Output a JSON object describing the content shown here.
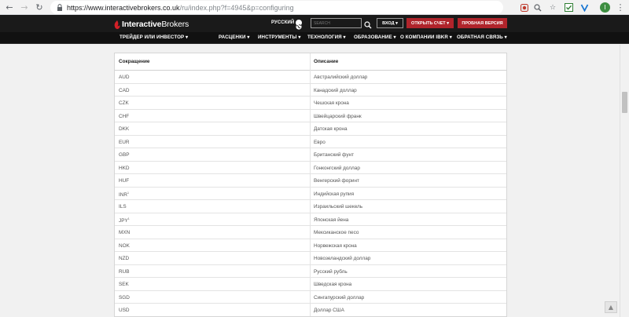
{
  "browser": {
    "url_host": "https://www.interactivebrokers.co.uk",
    "url_path": "/ru/index.php?f=4945&p=configuring",
    "back_icon": "arrow-left-icon",
    "forward_icon": "arrow-right-icon",
    "reload_icon": "reload-icon",
    "avatar_letter": "I",
    "menu_glyph": "⋮",
    "back_glyph": "←",
    "forward_glyph": "→",
    "reload_glyph": "↻",
    "star_glyph": "☆"
  },
  "header": {
    "language": "РУССКИЙ",
    "search_placeholder": "SEARCH",
    "login_label": "ВХОД ▾",
    "open_account_label": "ОТКРЫТЬ СЧЕТ ▾",
    "trial_label": "ПРОБНАЯ ВЕРСИЯ",
    "logo_bold": "Interactive",
    "logo_regular": "Brokers",
    "brand_color": "#b0242b"
  },
  "nav": {
    "items": [
      "ТРЕЙДЕР ИЛИ ИНВЕСТОР ▾",
      "РАСЦЕНКИ ▾",
      "ИНСТРУМЕНТЫ ▾",
      "ТЕХНОЛОГИЯ ▾",
      "ОБРАЗОВАНИЕ ▾",
      "О КОМПАНИИ IBKR ▾",
      "ОБРАТНАЯ СВЯЗЬ ▾"
    ]
  },
  "table": {
    "headers": [
      "Сокращение",
      "Описание"
    ],
    "rows": [
      {
        "code": "AUD",
        "sup": "",
        "desc": "Австралийский доллар"
      },
      {
        "code": "CAD",
        "sup": "",
        "desc": "Канадский доллар"
      },
      {
        "code": "CZK",
        "sup": "",
        "desc": "Чешская крона"
      },
      {
        "code": "CHF",
        "sup": "",
        "desc": "Швейцарский франк"
      },
      {
        "code": "DKK",
        "sup": "",
        "desc": "Датская крона"
      },
      {
        "code": "EUR",
        "sup": "",
        "desc": "Евро"
      },
      {
        "code": "GBP",
        "sup": "",
        "desc": "Британский фунт"
      },
      {
        "code": "HKD",
        "sup": "",
        "desc": "Гонконгский доллар"
      },
      {
        "code": "HUF",
        "sup": "",
        "desc": "Венгерский форинт"
      },
      {
        "code": "INR",
        "sup": "1",
        "desc": "Индийская рупия"
      },
      {
        "code": "ILS",
        "sup": "",
        "desc": "Израильский шекель"
      },
      {
        "code": "JPY",
        "sup": "1",
        "desc": "Японская йена"
      },
      {
        "code": "MXN",
        "sup": "",
        "desc": "Мексиканское песо"
      },
      {
        "code": "NOK",
        "sup": "",
        "desc": "Норвежская крона"
      },
      {
        "code": "NZD",
        "sup": "",
        "desc": "Новозеландский доллар"
      },
      {
        "code": "RUB",
        "sup": "",
        "desc": "Русский рубль"
      },
      {
        "code": "SEK",
        "sup": "",
        "desc": "Шведская крона"
      },
      {
        "code": "SGD",
        "sup": "",
        "desc": "Сингапурский доллар"
      },
      {
        "code": "USD",
        "sup": "",
        "desc": "Доллар США"
      }
    ]
  },
  "page": {
    "to_top_glyph": "▲"
  }
}
